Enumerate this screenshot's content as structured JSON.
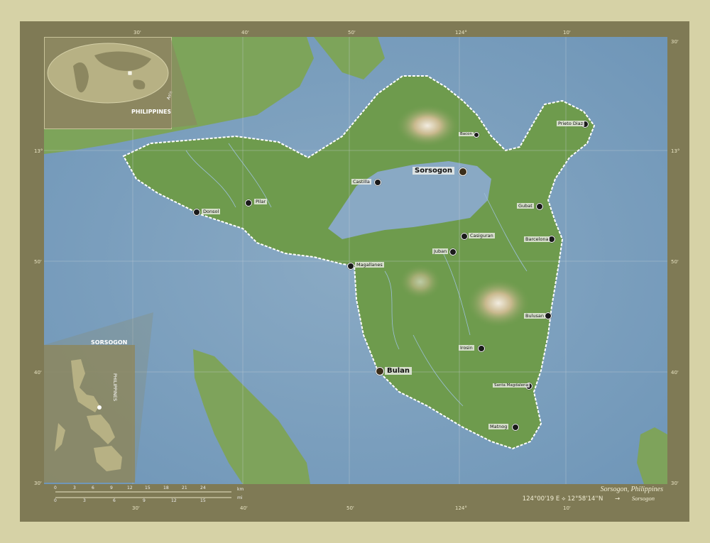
{
  "map": {
    "caption": "Sorsogon, Philippines",
    "coordinates": "124°00'19 E ⟡ 12°58'14''N",
    "arrow": "→",
    "region_short": "Sorsogon",
    "lat_labels": {
      "l13": "13°",
      "l50": "50'",
      "l40": "40'",
      "l30": "30'",
      "top_right_30": "30'"
    },
    "lon_labels": {
      "l30": "30'",
      "l40": "40'",
      "l50": "50'",
      "l124": "124°",
      "l10": "10'"
    },
    "scale": {
      "km_ticks": [
        "0",
        "3",
        "6",
        "9",
        "12",
        "15",
        "18",
        "21",
        "24"
      ],
      "mi_ticks": [
        "0",
        "3",
        "6",
        "9",
        "12",
        "15"
      ],
      "km_unit": "km",
      "mi_unit": "mi"
    },
    "colors": {
      "sea": "#7aa0bd",
      "land": "#6f9a4e",
      "frame": "#7f7a55",
      "border": "#ffffff"
    }
  },
  "insets": {
    "world": {
      "label": "PHILIPPINES",
      "region": "Asia"
    },
    "country": {
      "label": "SORSOGON",
      "country": "PHILIPPINES"
    }
  },
  "cities": {
    "sorsogon": "Sorsogon",
    "castilla": "Castilla",
    "pilar": "Pilar",
    "donsol": "Donsol",
    "magallanes": "Magallanes",
    "juban": "Juban",
    "casiguran": "Casiguran",
    "gubat": "Gubat",
    "barcelona": "Barcelona",
    "bulusan": "Bulusan",
    "irosin": "Irosin",
    "bulan": "Bulan",
    "santa_magdalena": "Santa Magdalena",
    "matnog": "Matnog",
    "prieto_diaz": "Prieto Diaz",
    "bacon": "Bacon"
  }
}
